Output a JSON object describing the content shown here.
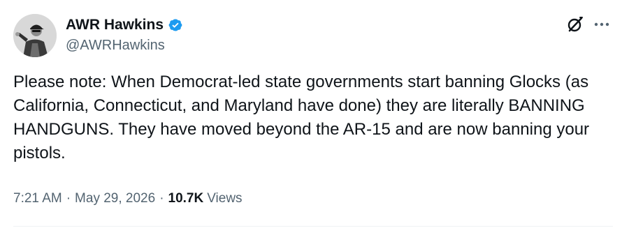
{
  "author": {
    "display_name": "AWR Hawkins",
    "handle": "@AWRHawkins",
    "verified": true,
    "verified_color": "#1d9bf0"
  },
  "header_actions": {
    "grok_icon": "grok-icon",
    "more_icon": "more-options-icon"
  },
  "tweet": {
    "text": "Please note: When Democrat-led state governments start banning Glocks (as California, Connecticut, and Maryland have done) they are literally BANNING HANDGUNS. They have moved beyond the AR-15 and are now banning your pistols."
  },
  "meta": {
    "time": "7:21 AM",
    "separator": "·",
    "date": "May 29, 2026",
    "views_count": "10.7K",
    "views_label": "Views"
  },
  "colors": {
    "text_primary": "#0f1419",
    "text_secondary": "#536471",
    "divider": "#eff3f4"
  }
}
